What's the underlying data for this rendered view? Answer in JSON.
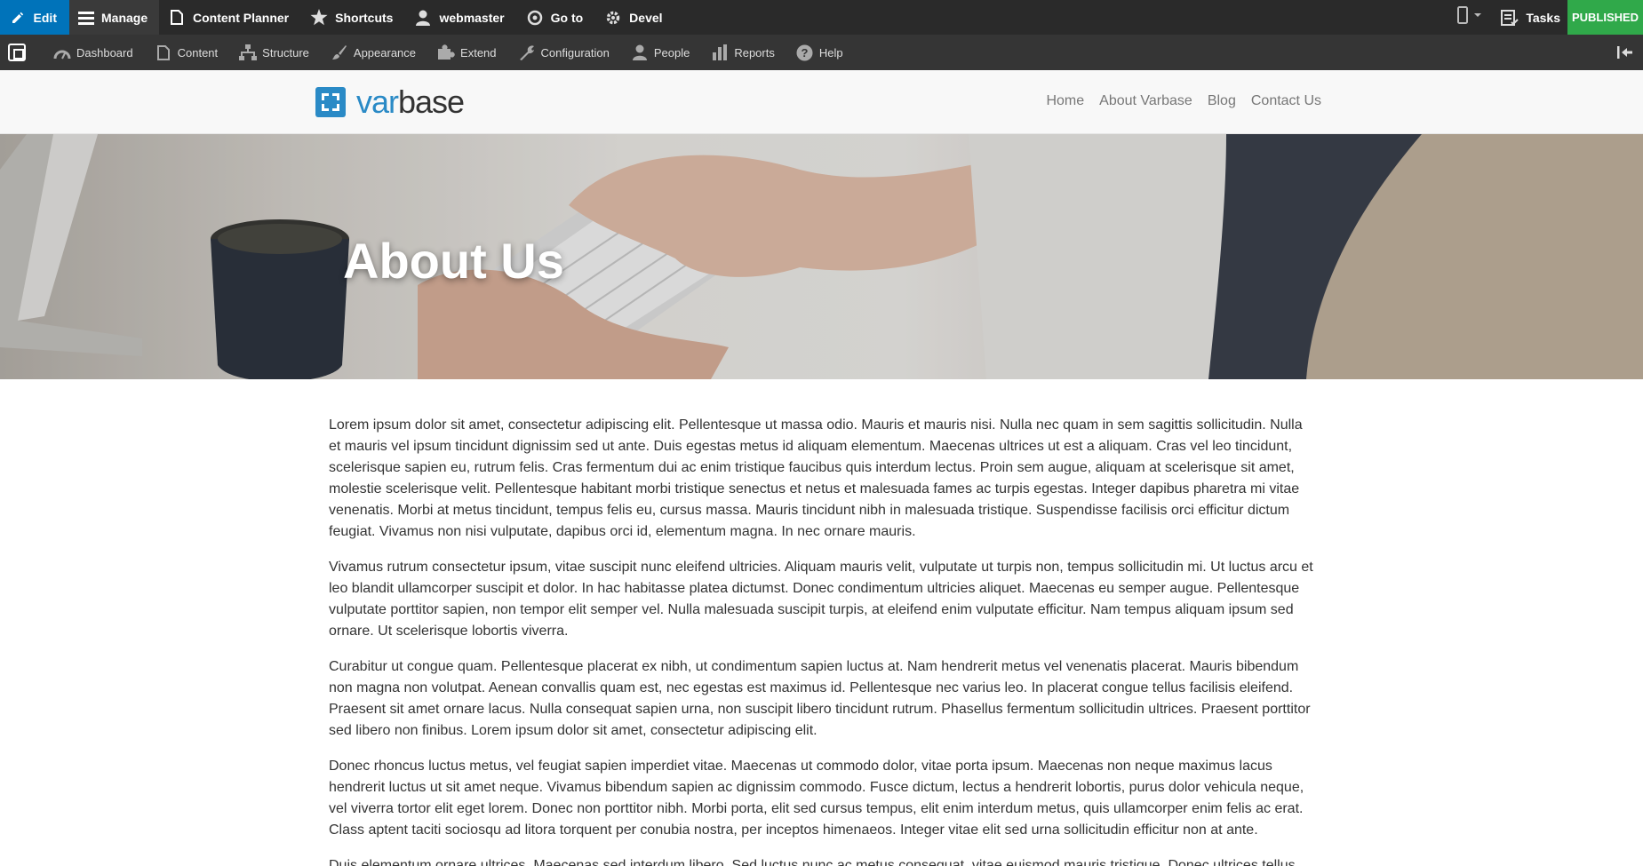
{
  "toolbar": {
    "edit": "Edit",
    "manage": "Manage",
    "content_planner": "Content Planner",
    "shortcuts": "Shortcuts",
    "user": "webmaster",
    "goto": "Go to",
    "devel": "Devel",
    "tasks": "Tasks",
    "status": "PUBLISHED",
    "colors": {
      "edit_bg": "#0073ba",
      "published_bg": "#30a94a",
      "bar_bg": "#2a2a2a"
    }
  },
  "tray": {
    "items": [
      {
        "label": "Dashboard",
        "icon": "dashboard-icon"
      },
      {
        "label": "Content",
        "icon": "document-icon"
      },
      {
        "label": "Structure",
        "icon": "sitemap-icon"
      },
      {
        "label": "Appearance",
        "icon": "brush-icon"
      },
      {
        "label": "Extend",
        "icon": "puzzle-icon"
      },
      {
        "label": "Configuration",
        "icon": "wrench-icon"
      },
      {
        "label": "People",
        "icon": "people-icon"
      },
      {
        "label": "Reports",
        "icon": "bar-chart-icon"
      },
      {
        "label": "Help",
        "icon": "help-icon"
      }
    ]
  },
  "site": {
    "brand_prefix": "var",
    "brand_suffix": "base",
    "nav": [
      "Home",
      "About Varbase",
      "Blog",
      "Contact Us"
    ]
  },
  "hero": {
    "title": "About Us"
  },
  "content": {
    "paragraphs": [
      "Lorem ipsum dolor sit amet, consectetur adipiscing elit. Pellentesque ut massa odio. Mauris et mauris nisi. Nulla nec quam in sem sagittis sollicitudin. Nulla et mauris vel ipsum tincidunt dignissim sed ut ante. Duis egestas metus id aliquam elementum. Maecenas ultrices ut est a aliquam. Cras vel leo tincidunt, scelerisque sapien eu, rutrum felis. Cras fermentum dui ac enim tristique faucibus quis interdum lectus. Proin sem augue, aliquam at scelerisque sit amet, molestie scelerisque velit. Pellentesque habitant morbi tristique senectus et netus et malesuada fames ac turpis egestas. Integer dapibus pharetra mi vitae venenatis. Morbi at metus tincidunt, tempus felis eu, cursus massa. Mauris tincidunt nibh in malesuada tristique. Suspendisse facilisis orci efficitur dictum feugiat. Vivamus non nisi vulputate, dapibus orci id, elementum magna. In nec ornare mauris.",
      "Vivamus rutrum consectetur ipsum, vitae suscipit nunc eleifend ultricies. Aliquam mauris velit, vulputate ut turpis non, tempus sollicitudin mi. Ut luctus arcu et leo blandit ullamcorper suscipit et dolor. In hac habitasse platea dictumst. Donec condimentum ultricies aliquet. Maecenas eu semper augue. Pellentesque vulputate porttitor sapien, non tempor elit semper vel. Nulla malesuada suscipit turpis, at eleifend enim vulputate efficitur. Nam tempus aliquam ipsum sed ornare. Ut scelerisque lobortis viverra.",
      "Curabitur ut congue quam. Pellentesque placerat ex nibh, ut condimentum sapien luctus at. Nam hendrerit metus vel venenatis placerat. Mauris bibendum non magna non volutpat. Aenean convallis quam est, nec egestas est maximus id. Pellentesque nec varius leo. In placerat congue tellus facilisis eleifend. Praesent sit amet ornare lacus. Nulla consequat sapien urna, non suscipit libero tincidunt rutrum. Phasellus fermentum sollicitudin ultrices. Praesent porttitor sed libero non finibus. Lorem ipsum dolor sit amet, consectetur adipiscing elit.",
      "Donec rhoncus luctus metus, vel feugiat sapien imperdiet vitae. Maecenas ut commodo dolor, vitae porta ipsum. Maecenas non neque maximus lacus hendrerit luctus ut sit amet neque. Vivamus bibendum sapien ac dignissim commodo. Fusce dictum, lectus a hendrerit lobortis, purus dolor vehicula neque, vel viverra tortor elit eget lorem. Donec non porttitor nibh. Morbi porta, elit sed cursus tempus, elit enim interdum metus, quis ullamcorper enim felis ac erat. Class aptent taciti sociosqu ad litora torquent per conubia nostra, per inceptos himenaeos. Integer vitae elit sed urna sollicitudin efficitur non at ante.",
      "Duis elementum ornare ultrices. Maecenas sed interdum libero. Sed luctus nunc ac metus consequat, vitae euismod mauris tristique. Donec ultrices tellus"
    ]
  }
}
